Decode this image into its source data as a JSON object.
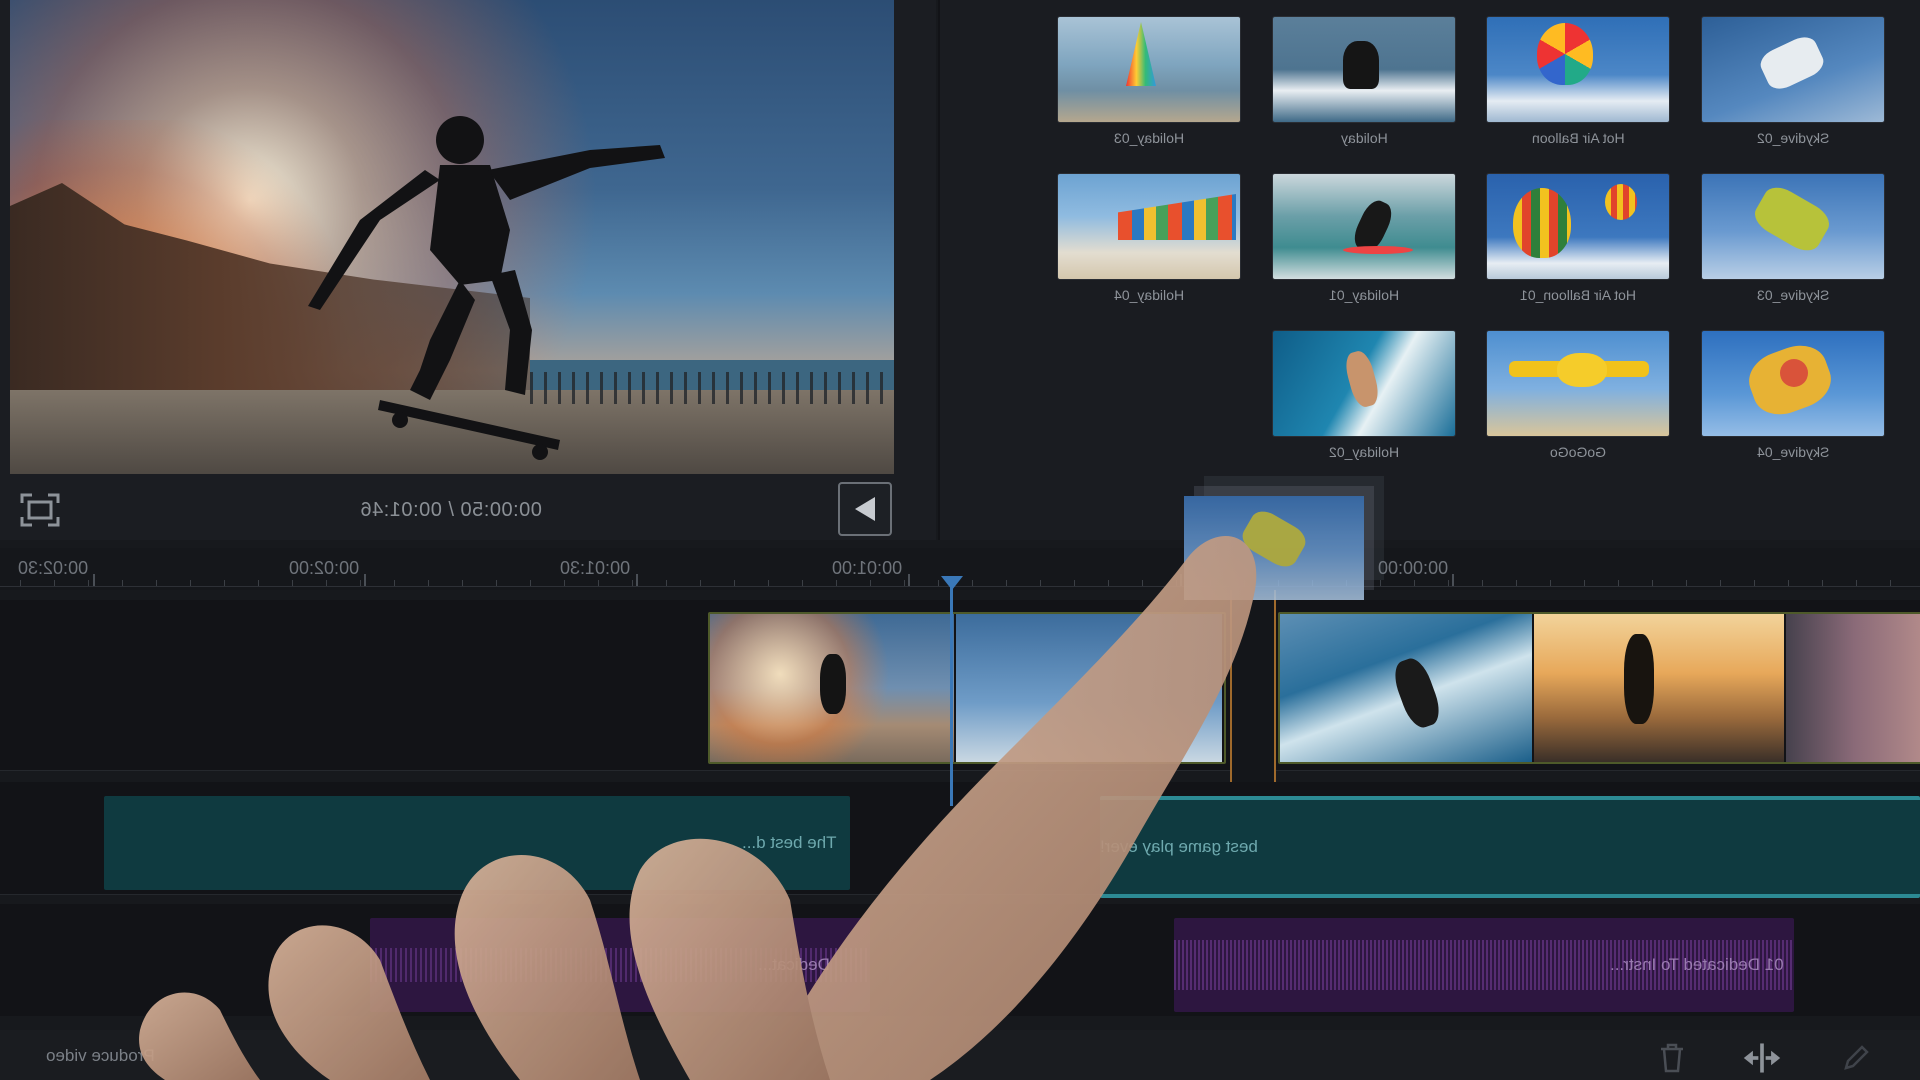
{
  "preview": {
    "timecode": "00:00:50 / 00:01:46"
  },
  "library": {
    "items": [
      {
        "label": "Holiday_03"
      },
      {
        "label": "Holiday"
      },
      {
        "label": "Hot Air Balloon"
      },
      {
        "label": "Skydive_02"
      },
      {
        "label": "Holiday_04"
      },
      {
        "label": "Holiday_01"
      },
      {
        "label": "Hot Air Balloon_01"
      },
      {
        "label": "Skydive_03"
      },
      {
        "label": "Holiday_02"
      },
      {
        "label": "GoGoGo"
      },
      {
        "label": "Skydive_04"
      }
    ]
  },
  "timeline": {
    "ruler_labels": [
      "00:00:00",
      "00:01:00",
      "00:01:30",
      "00:02:00",
      "00:02:30"
    ],
    "title_clips": [
      {
        "text": "The best d..."
      },
      {
        "text": "best game play ever!"
      }
    ],
    "audio_clips": [
      {
        "text": "Dedicat..."
      },
      {
        "text": "01 Dedicated To Instr..."
      }
    ]
  },
  "bottom_bar": {
    "project_name": "Produce video"
  },
  "icons": {
    "fullscreen": "fullscreen-icon",
    "play": "play-icon",
    "trash": "trash-icon",
    "split": "split-icon",
    "edit": "pencil-icon"
  },
  "colors": {
    "playhead": "#3a78b8",
    "title_track": "#0f3a40",
    "audio_track": "#2d1640",
    "clip_border": "#4e5a2a",
    "insert_marker": "#a06a2c"
  }
}
